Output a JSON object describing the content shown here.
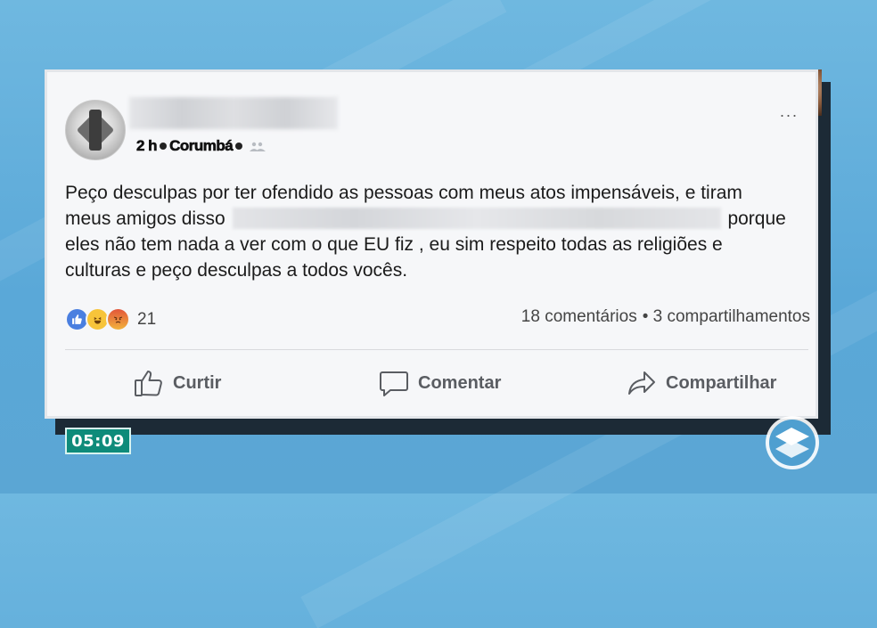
{
  "post": {
    "meta_time": "2 h",
    "meta_location": "Corumbá",
    "more_label": "...",
    "text_line1": "Peço desculpas por ter ofendido as pessoas com meus atos impensáveis, e tiram",
    "text_line2_before": "meus amigos disso",
    "text_line2_after": "porque",
    "text_line3": "eles não tem nada a ver com o que EU fiz , eu sim respeito todas as religiões e",
    "text_line4": "culturas e peço desculpas a todos vocês.",
    "reaction_icons": [
      "like-icon",
      "haha-icon",
      "angry-icon"
    ],
    "reaction_count": "21",
    "comments_count": "18 comentários",
    "shares_count": "• 3 compartilhamentos"
  },
  "actions": {
    "like_label": "Curtir",
    "comment_label": "Comentar",
    "share_label": "Compartilhar"
  },
  "broadcast": {
    "clock": "05:09"
  },
  "colors": {
    "background": "#5aa8d8",
    "card": "#f6f7f9",
    "like_blue": "#4a7fe0",
    "timestamp_green": "#0e8b7a"
  }
}
